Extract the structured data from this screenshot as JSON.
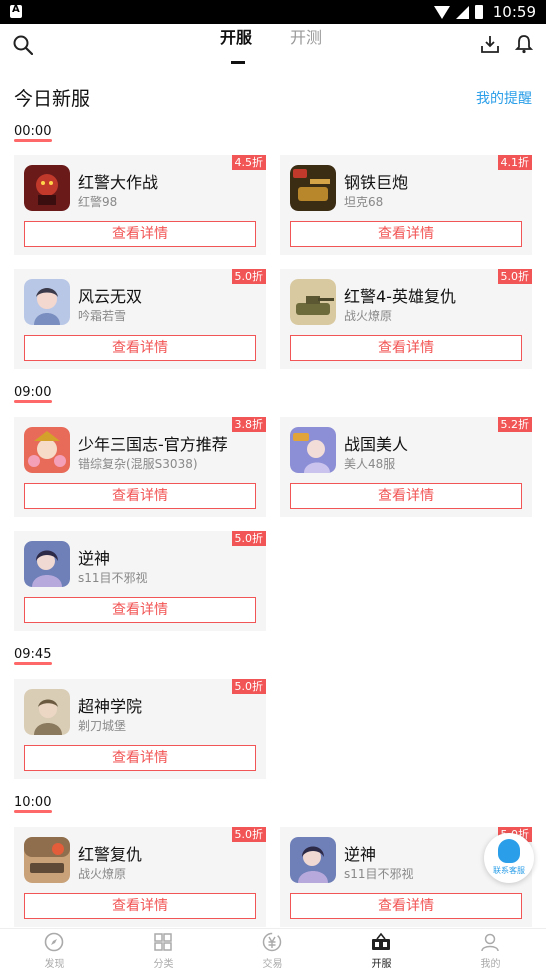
{
  "status_bar": {
    "time": "10:59"
  },
  "header": {
    "tabs": [
      {
        "label": "开服"
      },
      {
        "label": "开测"
      }
    ]
  },
  "section": {
    "title": "今日新服",
    "reminder": "我的提醒"
  },
  "detail_label": "查看详情",
  "time_groups": [
    {
      "time": "00:00"
    },
    {
      "time": "09:00"
    },
    {
      "time": "09:45"
    },
    {
      "time": "10:00"
    }
  ],
  "games": [
    {
      "name": "红警大作战",
      "server": "红警98",
      "discount": "4.5折",
      "icon": "game-icon-red-alert-battle"
    },
    {
      "name": "钢铁巨炮",
      "server": "坦克68",
      "discount": "4.1折",
      "icon": "game-icon-steel-cannon"
    },
    {
      "name": "风云无双",
      "server": "吟霜若雪",
      "discount": "5.0折",
      "icon": "game-icon-fengyun"
    },
    {
      "name": "红警4-英雄复仇",
      "server": "战火燎原",
      "discount": "5.0折",
      "icon": "game-icon-red-alert-4"
    },
    {
      "name": "少年三国志-官方推荐",
      "server": "错综复杂(混服S3038)",
      "discount": "3.8折",
      "icon": "game-icon-three-kingdoms"
    },
    {
      "name": "战国美人",
      "server": "美人48服",
      "discount": "5.2折",
      "icon": "game-icon-warring-beauty"
    },
    {
      "name": "逆神",
      "server": "s11目不邪视",
      "discount": "5.0折",
      "icon": "game-icon-nishen"
    },
    {
      "name": "超神学院",
      "server": "剃刀城堡",
      "discount": "5.0折",
      "icon": "game-icon-chaoshen"
    },
    {
      "name": "红警复仇",
      "server": "战火燎原",
      "discount": "5.0折",
      "icon": "game-icon-red-alert-revenge"
    },
    {
      "name": "逆神",
      "server": "s11目不邪视",
      "discount": "5.0折",
      "icon": "game-icon-nishen"
    }
  ],
  "support": {
    "label": "联系客服"
  },
  "bottom_nav": [
    {
      "label": "发现",
      "icon": "compass-icon"
    },
    {
      "label": "分类",
      "icon": "grid-icon"
    },
    {
      "label": "交易",
      "icon": "yen-icon"
    },
    {
      "label": "开服",
      "icon": "server-icon",
      "active": true
    },
    {
      "label": "我的",
      "icon": "person-icon"
    }
  ],
  "colors": {
    "accent": "#f25555",
    "link": "#2a9ee8"
  }
}
